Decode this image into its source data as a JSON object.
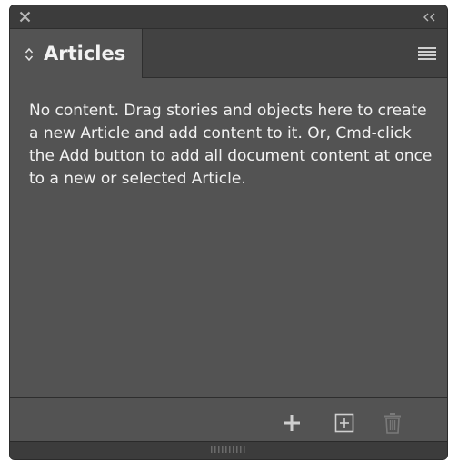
{
  "panel": {
    "tab_label": "Articles",
    "empty_message": "No content. Drag stories and objects here to create a new Article and add content to it. Or, Cmd-click the Add button to add all document content at once to a new or selected Article."
  },
  "icons": {
    "close": "close-icon",
    "collapse": "double-chevron-left-icon",
    "sort": "up-down-arrows-icon",
    "menu": "hamburger-menu-icon",
    "add": "plus-icon",
    "new_article": "new-article-icon",
    "delete": "trash-icon",
    "grip": "resize-grip-icon"
  },
  "colors": {
    "panel_bg": "#535353",
    "header_bg": "#3c3c3c",
    "text": "#f2f2f2",
    "icon": "#cfcfcf",
    "icon_disabled": "#7a7a7a"
  }
}
